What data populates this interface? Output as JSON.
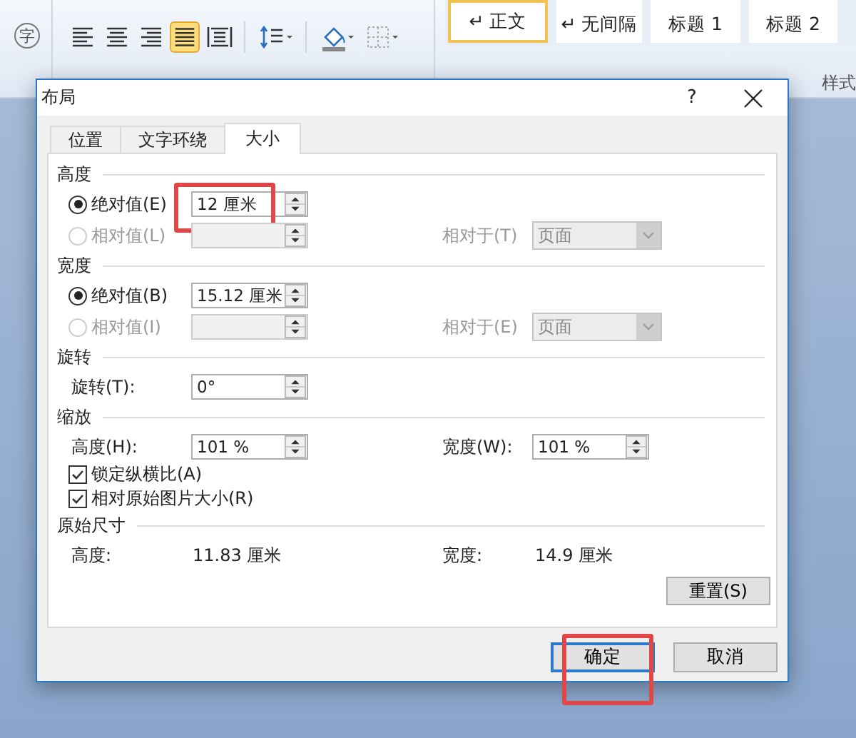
{
  "ribbon": {
    "phonetic_button": "字",
    "paragraph_tools": [
      {
        "kind": "align-left",
        "selected": false
      },
      {
        "kind": "align-center",
        "selected": false
      },
      {
        "kind": "align-right",
        "selected": false
      },
      {
        "kind": "justify",
        "selected": true
      },
      {
        "kind": "distribute",
        "selected": false
      },
      {
        "kind": "line-spacing",
        "selected": false
      },
      {
        "kind": "shading",
        "selected": false
      },
      {
        "kind": "borders",
        "selected": false
      }
    ],
    "styles": [
      {
        "label": "↵ 正文",
        "selected": true
      },
      {
        "label": "↵ 无间隔",
        "selected": false
      },
      {
        "label": "标题 1",
        "selected": false
      },
      {
        "label": "标题 2",
        "selected": false
      }
    ],
    "styles_group_label": "样式"
  },
  "dialog": {
    "title": "布局",
    "help": "?",
    "tabs": [
      {
        "label": "位置",
        "selected": false
      },
      {
        "label": "文字环绕",
        "selected": false
      },
      {
        "label": "大小",
        "selected": true
      }
    ],
    "sections": [
      {
        "title": "高度",
        "rows": [
          {
            "kind": "option",
            "label": "绝对值(E)",
            "selected": true,
            "disabled": false,
            "value": "12 厘米",
            "annotated": true
          },
          {
            "kind": "option",
            "label": "相对值(L)",
            "selected": false,
            "disabled": true,
            "relative_label": "相对于(T)",
            "relative_value": "页面"
          }
        ]
      },
      {
        "title": "宽度",
        "rows": [
          {
            "kind": "option",
            "label": "绝对值(B)",
            "selected": true,
            "disabled": false,
            "value": "15.12 厘米",
            "annotated": false
          },
          {
            "kind": "option",
            "label": "相对值(I)",
            "selected": false,
            "disabled": true,
            "relative_label": "相对于(E)",
            "relative_value": "页面"
          }
        ]
      },
      {
        "title": "旋转",
        "rows": [
          {
            "kind": "field",
            "label": "旋转(T):",
            "value": "0°"
          }
        ]
      },
      {
        "title": "缩放",
        "rows": [
          {
            "kind": "field",
            "label": "高度(H):",
            "value": "101 %",
            "second_label": "宽度(W):",
            "second_value": "101 %"
          },
          {
            "kind": "checkbox",
            "label": "锁定纵横比(A)",
            "checked": true
          },
          {
            "kind": "checkbox",
            "label": "相对原始图片大小(R)",
            "checked": true
          }
        ]
      },
      {
        "title": "原始尺寸",
        "rows": [
          {
            "kind": "info",
            "label": "高度:",
            "value": "11.83 厘米",
            "second_label": "宽度:",
            "second_value": "14.9 厘米"
          }
        ]
      }
    ],
    "reset_button": "重置(S)",
    "buttons": [
      {
        "label": "确定",
        "default": true,
        "annotated": true
      },
      {
        "label": "取消",
        "default": false,
        "annotated": false
      }
    ]
  }
}
